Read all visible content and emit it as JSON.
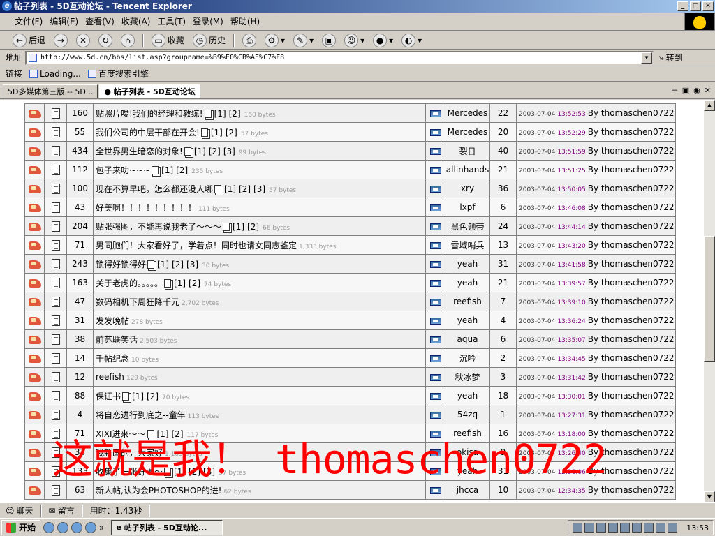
{
  "window": {
    "title": "帖子列表 - 5D互动论坛 - Tencent Explorer"
  },
  "menu": [
    "文件(F)",
    "编辑(E)",
    "查看(V)",
    "收藏(A)",
    "工具(T)",
    "登录(M)",
    "帮助(H)"
  ],
  "toolbar": {
    "back": "后退",
    "favorites": "收藏",
    "history": "历史"
  },
  "address": {
    "label": "地址",
    "url": "http://www.5d.cn/bbs/list.asp?groupname=%B9%E0%CB%AE%C7%F8",
    "go": "转到"
  },
  "links": {
    "label": "链接",
    "items": [
      "Loading...",
      "百度搜索引擎"
    ]
  },
  "tabs": [
    {
      "label": "5D多媒体第三版 -- 5D..."
    },
    {
      "label": "帖子列表 - 5D互动论坛"
    }
  ],
  "topics": [
    {
      "hits": "160",
      "title": "贴照片喽!我们的经理和教练!",
      "pages": [
        "[1]",
        "[2]"
      ],
      "bytes": "160 bytes",
      "author": "Mercedes",
      "replies": "22",
      "date": "2003-07-04",
      "time": "13:52:53",
      "by": "By thomaschen0722"
    },
    {
      "hits": "55",
      "title": "我们公司的中层干部在开会!",
      "pages": [
        "[1]",
        "[2]"
      ],
      "bytes": "57 bytes",
      "author": "Mercedes",
      "replies": "20",
      "date": "2003-07-04",
      "time": "13:52:29",
      "by": "By thomaschen0722"
    },
    {
      "hits": "434",
      "title": "全世界男生暗恋的对象!",
      "pages": [
        "[1]",
        "[2]",
        "[3]"
      ],
      "bytes": "99 bytes",
      "author": "裂日",
      "replies": "40",
      "date": "2003-07-04",
      "time": "13:51:59",
      "by": "By thomaschen0722"
    },
    {
      "hits": "112",
      "title": "包子来叻~~~",
      "pages": [
        "[1]",
        "[2]"
      ],
      "bytes": "235 bytes",
      "author": "allinhands",
      "replies": "21",
      "date": "2003-07-04",
      "time": "13:51:25",
      "by": "By thomaschen0722"
    },
    {
      "hits": "100",
      "title": "现在不算早吧，怎么都还没人哪",
      "pages": [
        "[1]",
        "[2]",
        "[3]"
      ],
      "bytes": "57 bytes",
      "author": "xry",
      "replies": "36",
      "date": "2003-07-04",
      "time": "13:50:05",
      "by": "By thomaschen0722"
    },
    {
      "hits": "43",
      "title": "好美啊！！！！！！！！！",
      "pages": [],
      "bytes": "111 bytes",
      "author": "lxpf",
      "replies": "6",
      "date": "2003-07-04",
      "time": "13:46:08",
      "by": "By thomaschen0722"
    },
    {
      "hits": "204",
      "title": "贴张强图，不能再说我老了～～～",
      "pages": [
        "[1]",
        "[2]"
      ],
      "bytes": "66 bytes",
      "author": "黑色领带",
      "replies": "24",
      "date": "2003-07-04",
      "time": "13:44:14",
      "by": "By thomaschen0722"
    },
    {
      "hits": "71",
      "title": "男同胞们！大家看好了，学着点！同时也请女同志鉴定",
      "pages": [],
      "bytes": "1,333 bytes",
      "author": "雪域哨兵",
      "replies": "13",
      "date": "2003-07-04",
      "time": "13:43:20",
      "by": "By thomaschen0722"
    },
    {
      "hits": "243",
      "title": "锁得好锁得好",
      "pages": [
        "[1]",
        "[2]",
        "[3]"
      ],
      "bytes": "30 bytes",
      "author": "yeah",
      "replies": "31",
      "date": "2003-07-04",
      "time": "13:41:58",
      "by": "By thomaschen0722"
    },
    {
      "hits": "163",
      "title": "关于老虎的。。。。。",
      "pages": [
        "[1]",
        "[2]"
      ],
      "bytes": "74 bytes",
      "author": "yeah",
      "replies": "21",
      "date": "2003-07-04",
      "time": "13:39:57",
      "by": "By thomaschen0722"
    },
    {
      "hits": "47",
      "title": "数码相机下周狂降千元",
      "pages": [],
      "bytes": "2,702 bytes",
      "author": "reefish",
      "replies": "7",
      "date": "2003-07-04",
      "time": "13:39:10",
      "by": "By thomaschen0722"
    },
    {
      "hits": "31",
      "title": "发发晚帖",
      "pages": [],
      "bytes": "278 bytes",
      "author": "yeah",
      "replies": "4",
      "date": "2003-07-04",
      "time": "13:36:24",
      "by": "By thomaschen0722"
    },
    {
      "hits": "38",
      "title": "前苏联笑话",
      "pages": [],
      "bytes": "2,503 bytes",
      "author": "aqua",
      "replies": "6",
      "date": "2003-07-04",
      "time": "13:35:07",
      "by": "By thomaschen0722"
    },
    {
      "hits": "14",
      "title": "千帖纪念",
      "pages": [],
      "bytes": "10 bytes",
      "author": "沉吟",
      "replies": "2",
      "date": "2003-07-04",
      "time": "13:34:45",
      "by": "By thomaschen0722"
    },
    {
      "hits": "12",
      "title": "reefish",
      "pages": [],
      "bytes": "129 bytes",
      "author": "秋冰梦",
      "replies": "3",
      "date": "2003-07-04",
      "time": "13:31:42",
      "by": "By thomaschen0722"
    },
    {
      "hits": "88",
      "title": "保证书",
      "pages": [
        "[1]",
        "[2]"
      ],
      "bytes": "70 bytes",
      "author": "yeah",
      "replies": "18",
      "date": "2003-07-04",
      "time": "13:30:01",
      "by": "By thomaschen0722"
    },
    {
      "hits": "4",
      "title": "将自恋进行到底之--童年",
      "pages": [],
      "bytes": "113 bytes",
      "author": "54zq",
      "replies": "1",
      "date": "2003-07-04",
      "time": "13:27:31",
      "by": "By thomaschen0722"
    },
    {
      "hits": "71",
      "title": "XIXI进来～～",
      "pages": [
        "[1]",
        "[2]"
      ],
      "bytes": "117 bytes",
      "author": "reefish",
      "replies": "16",
      "date": "2003-07-04",
      "time": "13:18:00",
      "by": "By thomaschen0722"
    },
    {
      "hits": "33",
      "title": "我新画的，大家好",
      "pages": [],
      "bytes": "1,105 bytes",
      "author": "okisa",
      "replies": "9",
      "date": "2003-07-04",
      "time": "13:26:40",
      "by": "By thomaschen0722"
    },
    {
      "hits": "133",
      "title": "收集了一张好图～",
      "pages": [
        "[1]",
        "[2]",
        "[3]"
      ],
      "bytes": "57 bytes",
      "author": "yeah",
      "replies": "31",
      "date": "2003-07-04",
      "time": "12:36:06",
      "by": "By thomaschen0722"
    },
    {
      "hits": "63",
      "title": "新人帖,认为会PHOTOSHOP的进!",
      "pages": [],
      "bytes": "62 bytes",
      "author": "jhcca",
      "replies": "10",
      "date": "2003-07-04",
      "time": "12:34:35",
      "by": "By thomaschen0722"
    }
  ],
  "watermark": "这就是我！ thomaschen0722",
  "status": {
    "chat": "聊天",
    "message": "留言",
    "time": "用时：1.43秒"
  },
  "taskbar": {
    "start": "开始",
    "item": "帖子列表 - 5D互动论...",
    "clock": "13:53"
  }
}
